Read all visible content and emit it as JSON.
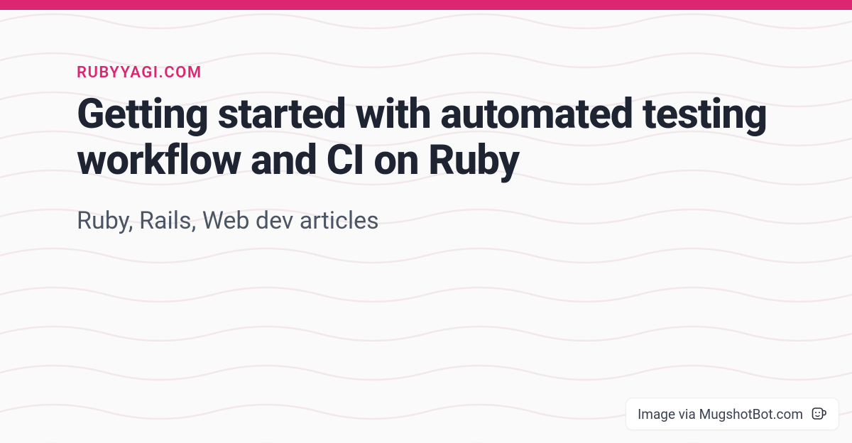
{
  "site_label": "RUBYYAGI.COM",
  "title": "Getting started with automated testing workflow and CI on Ruby",
  "subtitle": "Ruby, Rails, Web dev articles",
  "credit": "Image via MugshotBot.com",
  "colors": {
    "accent": "#dc2671",
    "heading": "#1f2433",
    "subtitle": "#4b5563"
  }
}
